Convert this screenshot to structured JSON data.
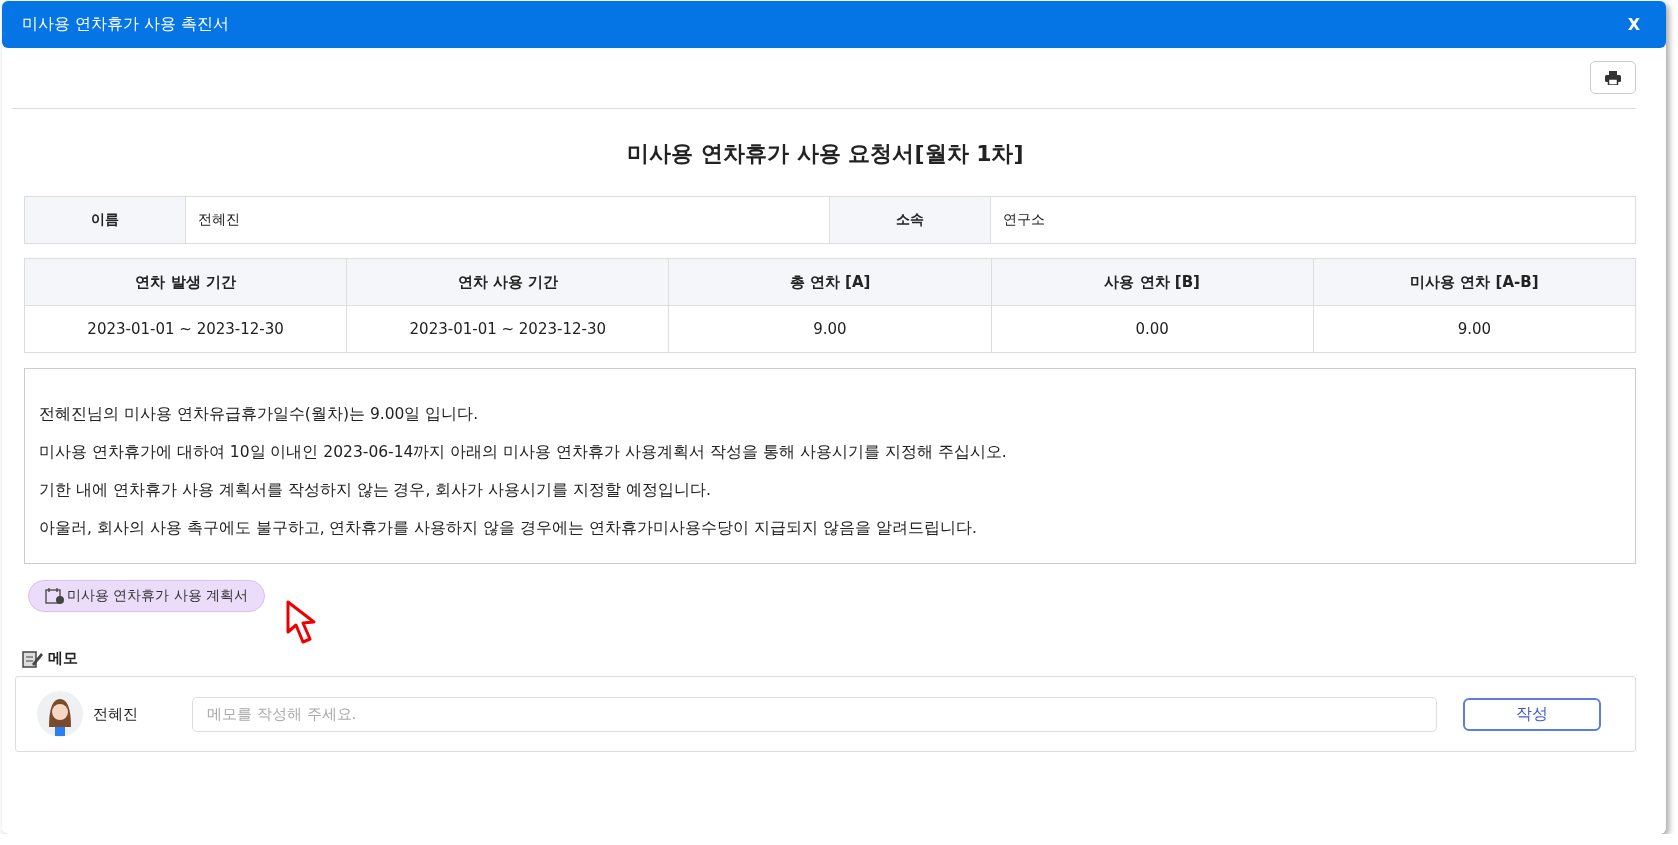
{
  "window": {
    "title": "미사용 연차휴가 사용 촉진서",
    "close_label": "X"
  },
  "document": {
    "title": "미사용 연차휴가 사용 요청서[월차 1차]",
    "info": [
      {
        "label": "이름",
        "value": "전혜진"
      },
      {
        "label": "소속",
        "value": "연구소"
      }
    ],
    "leave_table": {
      "columns": [
        "연차 발생 기간",
        "연차 사용 기간",
        "총 연차 [A]",
        "사용 연차 [B]",
        "미사용 연차 [A-B]"
      ],
      "rows": [
        [
          "2023-01-01 ~ 2023-12-30",
          "2023-01-01 ~ 2023-12-30",
          "9.00",
          "0.00",
          "9.00"
        ]
      ]
    },
    "notice": [
      "전혜진님의 미사용 연차유급휴가일수(월차)는 9.00일 입니다.",
      "미사용 연차휴가에 대하여 10일 이내인 2023-06-14까지 아래의 미사용 연차휴가 사용계획서 작성을 통해 사용시기를 지정해 주십시오.",
      "기한 내에 연차휴가 사용 계획서를 작성하지 않는 경우, 회사가 사용시기를 지정할 예정입니다.",
      "아울러, 회사의 사용 촉구에도 불구하고, 연차휴가를 사용하지 않을 경우에는 연차휴가미사용수당이 지급되지 않음을 알려드립니다."
    ],
    "plan_button": "미사용 연차휴가 사용 계획서"
  },
  "memo": {
    "heading": "메모",
    "author": "전혜진",
    "placeholder": "메모를 작성해 주세요.",
    "submit": "작성"
  }
}
